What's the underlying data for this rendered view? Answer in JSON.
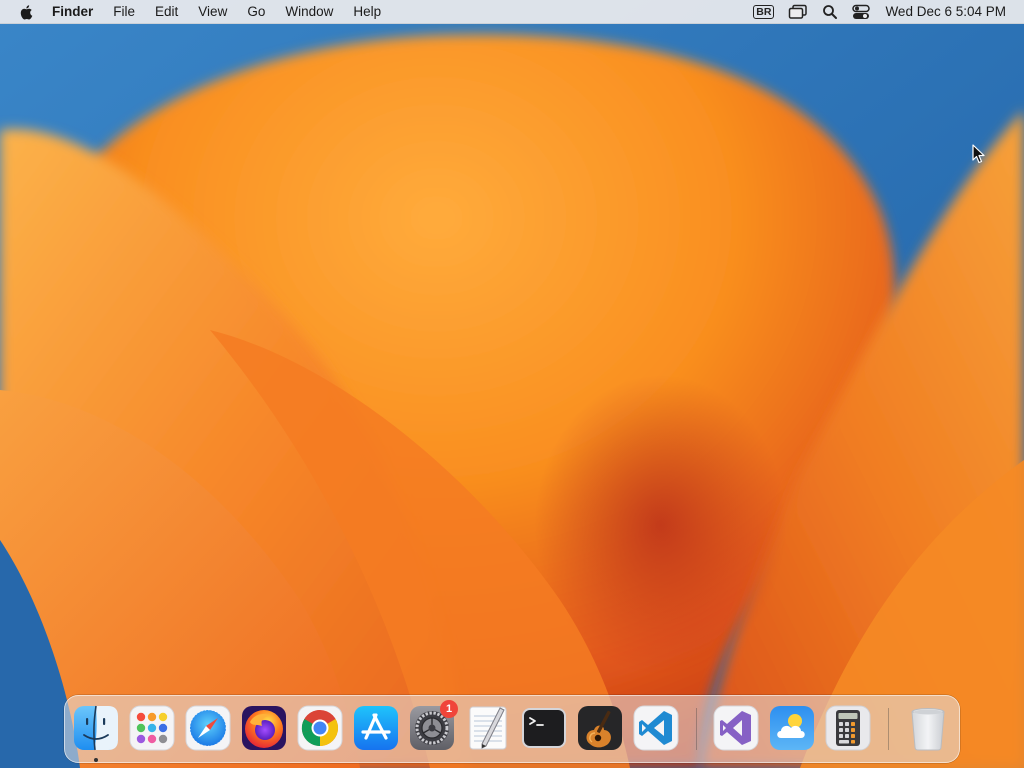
{
  "menubar": {
    "app_name": "Finder",
    "menus": [
      "File",
      "Edit",
      "View",
      "Go",
      "Window",
      "Help"
    ],
    "input_source": "BR",
    "clock": "Wed Dec 6  5:04 PM"
  },
  "dock": {
    "apps": [
      {
        "name": "Finder",
        "icon": "finder-icon",
        "running": true
      },
      {
        "name": "Launchpad",
        "icon": "launchpad-icon"
      },
      {
        "name": "Safari",
        "icon": "safari-icon"
      },
      {
        "name": "Firefox",
        "icon": "firefox-icon"
      },
      {
        "name": "Google Chrome",
        "icon": "chrome-icon"
      },
      {
        "name": "App Store",
        "icon": "app-store-icon"
      },
      {
        "name": "System Settings",
        "icon": "system-settings-icon",
        "badge": "1"
      },
      {
        "name": "TextEdit",
        "icon": "textedit-icon"
      },
      {
        "name": "Terminal",
        "icon": "terminal-icon"
      },
      {
        "name": "GarageBand",
        "icon": "garageband-icon"
      },
      {
        "name": "Visual Studio Code",
        "icon": "vscode-icon"
      },
      {
        "name": "Visual Studio",
        "icon": "visual-studio-icon"
      },
      {
        "name": "Weather",
        "icon": "weather-icon"
      },
      {
        "name": "Calculator",
        "icon": "calculator-icon"
      },
      {
        "name": "Trash",
        "icon": "trash-icon"
      }
    ]
  },
  "colors": {
    "wallpaper_blue": "#2a72b6",
    "wallpaper_orange": "#f58a1f",
    "badge_red": "#f0453a"
  }
}
